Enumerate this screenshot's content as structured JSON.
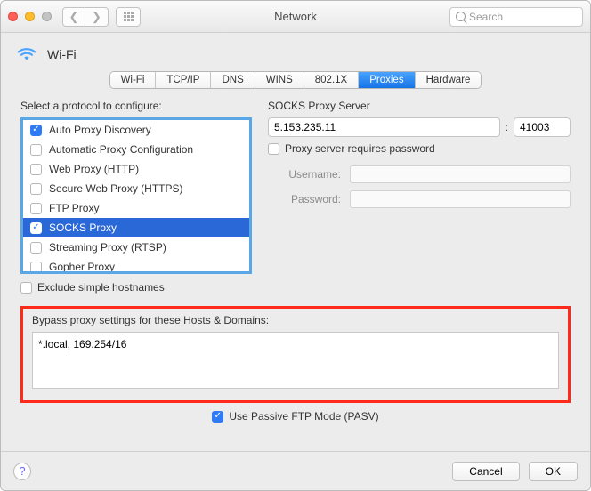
{
  "window": {
    "title": "Network"
  },
  "toolbar": {
    "search_placeholder": "Search"
  },
  "header": {
    "interface": "Wi-Fi"
  },
  "tabs": [
    "Wi-Fi",
    "TCP/IP",
    "DNS",
    "WINS",
    "802.1X",
    "Proxies",
    "Hardware"
  ],
  "active_tab": "Proxies",
  "left": {
    "select_label": "Select a protocol to configure:",
    "protocols": [
      {
        "label": "Auto Proxy Discovery",
        "checked": true,
        "selected": false
      },
      {
        "label": "Automatic Proxy Configuration",
        "checked": false,
        "selected": false
      },
      {
        "label": "Web Proxy (HTTP)",
        "checked": false,
        "selected": false
      },
      {
        "label": "Secure Web Proxy (HTTPS)",
        "checked": false,
        "selected": false
      },
      {
        "label": "FTP Proxy",
        "checked": false,
        "selected": false
      },
      {
        "label": "SOCKS Proxy",
        "checked": true,
        "selected": true
      },
      {
        "label": "Streaming Proxy (RTSP)",
        "checked": false,
        "selected": false
      },
      {
        "label": "Gopher Proxy",
        "checked": false,
        "selected": false
      }
    ],
    "exclude_label": "Exclude simple hostnames",
    "exclude_checked": false
  },
  "right": {
    "server_label": "SOCKS Proxy Server",
    "server_ip": "5.153.235.11",
    "server_port": "41003",
    "requires_password_label": "Proxy server requires password",
    "requires_password_checked": false,
    "username_label": "Username:",
    "username_value": "",
    "password_label": "Password:",
    "password_value": ""
  },
  "bypass": {
    "label": "Bypass proxy settings for these Hosts & Domains:",
    "value": "*.local, 169.254/16"
  },
  "pasv": {
    "label": "Use Passive FTP Mode (PASV)",
    "checked": true
  },
  "footer": {
    "cancel": "Cancel",
    "ok": "OK"
  }
}
